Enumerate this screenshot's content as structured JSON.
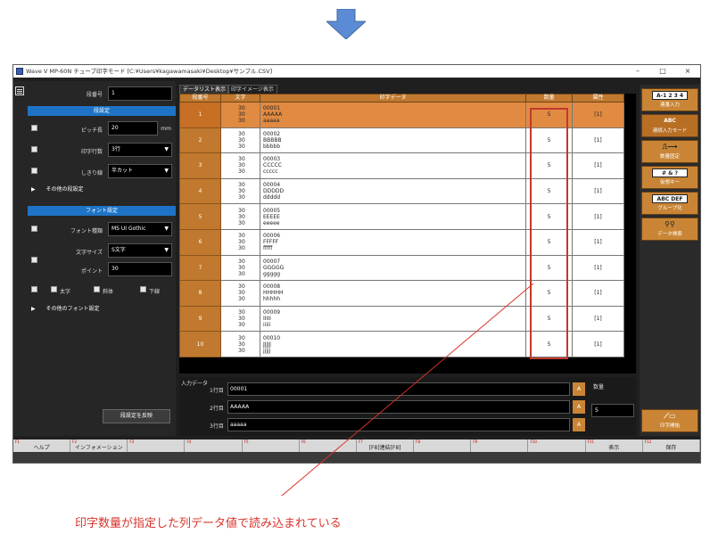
{
  "colors": {
    "accent_orange": "#c0792e",
    "section_blue": "#1e73c6",
    "annotation_red": "#c0392b"
  },
  "window": {
    "title": "Wave V  MP-60N チューブ印字モード [C:¥Users¥kagawamasaki¥Desktop¥サンプル.CSV]",
    "minimize": "–",
    "maximize": "□",
    "close": "×"
  },
  "left": {
    "rank_label": "段番号",
    "rank_value": "1",
    "section1": "段設定",
    "pitch_label": "ピッチ長",
    "pitch_value": "20",
    "pitch_unit": "mm",
    "lines_label": "印字行数",
    "lines_value": "3行",
    "cut_label": "しきり線",
    "cut_value": "半カット",
    "other_settings": "その他の段設定",
    "section2": "フォント設定",
    "font_label": "フォント種類",
    "font_value": "MS UI Gothic",
    "size_label": "文字サイズ",
    "size_value": "S文字",
    "point_label": "ポイント",
    "point_value": "30",
    "bold_label": "太字",
    "italic_label": "斜体",
    "underline_label": "下線",
    "other_font": "その他のフォント設定",
    "reflect_button": "段設定を反映"
  },
  "tabs": [
    "データリスト表示",
    "印字イメージ表示"
  ],
  "table": {
    "headers": [
      "段番号",
      "文字",
      "印字データ",
      "数量",
      "属性"
    ],
    "rows": [
      {
        "num": "1",
        "sizes": [
          "30",
          "30",
          "30"
        ],
        "data": [
          "00001",
          "AAAAA",
          "aaaaa"
        ],
        "qty": "5",
        "attr": "[1]"
      },
      {
        "num": "2",
        "sizes": [
          "30",
          "30",
          "30"
        ],
        "data": [
          "00002",
          "BBBBB",
          "bbbbb"
        ],
        "qty": "5",
        "attr": "[1]"
      },
      {
        "num": "3",
        "sizes": [
          "30",
          "30",
          "30"
        ],
        "data": [
          "00003",
          "CCCCC",
          "ccccc"
        ],
        "qty": "5",
        "attr": "[1]"
      },
      {
        "num": "4",
        "sizes": [
          "30",
          "30",
          "30"
        ],
        "data": [
          "00004",
          "DDDDD",
          "ddddd"
        ],
        "qty": "5",
        "attr": "[1]"
      },
      {
        "num": "5",
        "sizes": [
          "30",
          "30",
          "30"
        ],
        "data": [
          "00005",
          "EEEEE",
          "eeeee"
        ],
        "qty": "5",
        "attr": "[1]"
      },
      {
        "num": "6",
        "sizes": [
          "30",
          "30",
          "30"
        ],
        "data": [
          "00006",
          "FFFFF",
          "fffff"
        ],
        "qty": "5",
        "attr": "[1]"
      },
      {
        "num": "7",
        "sizes": [
          "30",
          "30",
          "30"
        ],
        "data": [
          "00007",
          "GGGGG",
          "ggggg"
        ],
        "qty": "5",
        "attr": "[1]"
      },
      {
        "num": "8",
        "sizes": [
          "30",
          "30",
          "30"
        ],
        "data": [
          "00008",
          "HHHHH",
          "hhhhh"
        ],
        "qty": "5",
        "attr": "[1]"
      },
      {
        "num": "9",
        "sizes": [
          "30",
          "30",
          "30"
        ],
        "data": [
          "00009",
          "IIIII",
          "iiiii"
        ],
        "qty": "5",
        "attr": "[1]"
      },
      {
        "num": "10",
        "sizes": [
          "30",
          "30",
          "30"
        ],
        "data": [
          "00010",
          "JJJJJ",
          "jjjjj"
        ],
        "qty": "5",
        "attr": "[1]"
      }
    ]
  },
  "input": {
    "title": "入力データ",
    "line1_label": "1行目",
    "line1_value": "00001",
    "line2_label": "2行目",
    "line2_value": "AAAAA",
    "line3_label": "3行目",
    "line3_value": "aaaaa",
    "a_label": "A",
    "qty_label": "数量",
    "qty_value": "5"
  },
  "right": {
    "serial_icon": "A-1 2 3 4",
    "serial_label": "連番入力",
    "continuous_icon": "ABC",
    "continuous_label": "連続入力モード",
    "qty_fix_label": "数量固定",
    "dakuten_icon": "# & ?",
    "dakuten_label": "仮想キー",
    "group_icon": "ABC DEF",
    "group_label": "グループ化",
    "search_label": "データ検索",
    "print_label": "印字開始"
  },
  "fkeys": [
    {
      "num": "F1",
      "label": "ヘルプ"
    },
    {
      "num": "F2",
      "label": "インフォメーション"
    },
    {
      "num": "F3",
      "label": ""
    },
    {
      "num": "F4",
      "label": ""
    },
    {
      "num": "F5",
      "label": ""
    },
    {
      "num": "F6",
      "label": ""
    },
    {
      "num": "F7",
      "label": "[F8]連結[F8]"
    },
    {
      "num": "F8",
      "label": ""
    },
    {
      "num": "F9",
      "label": ""
    },
    {
      "num": "F10",
      "label": ""
    },
    {
      "num": "F11",
      "label": "表示"
    },
    {
      "num": "F12",
      "label": "保存"
    }
  ],
  "annotation": "印字数量が指定した列データ値で読み込まれている"
}
